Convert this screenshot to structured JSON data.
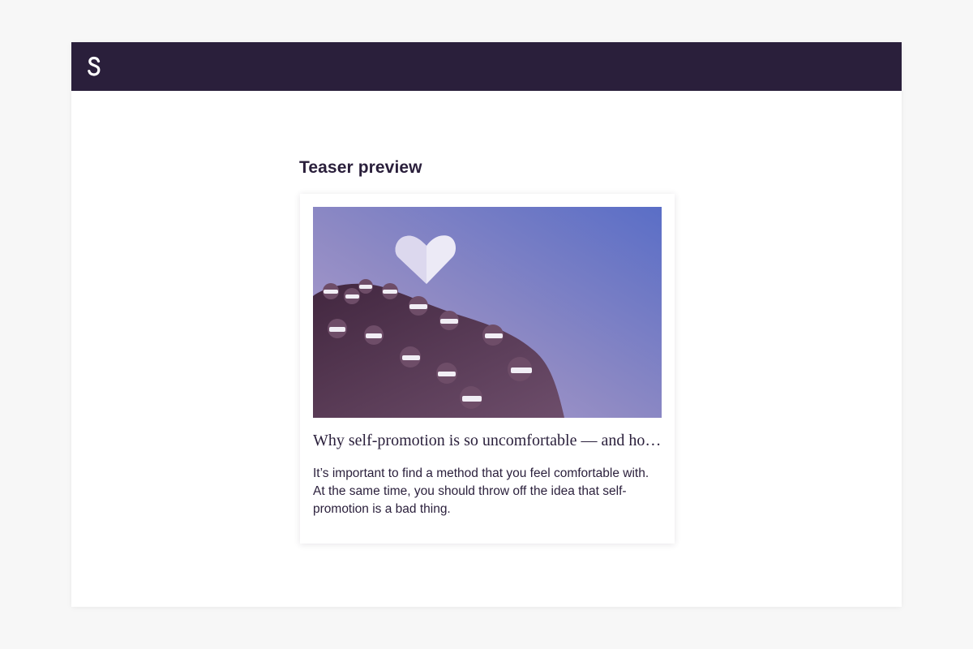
{
  "header": {
    "logo_icon": "s-logo-icon"
  },
  "teaser": {
    "section_title": "Teaser preview",
    "image_icon": "audience-3d-glasses-heart-image",
    "headline": "Why self-promotion is so uncomfortable — and how to deal with it",
    "excerpt": "It’s important to find a method that you feel comfortable with. At the same time, you should throw off the idea that self-promotion is a bad thing."
  },
  "colors": {
    "header_bg": "#2a1f3b",
    "text": "#2a1f3b",
    "page_bg": "#f7f7f7"
  }
}
